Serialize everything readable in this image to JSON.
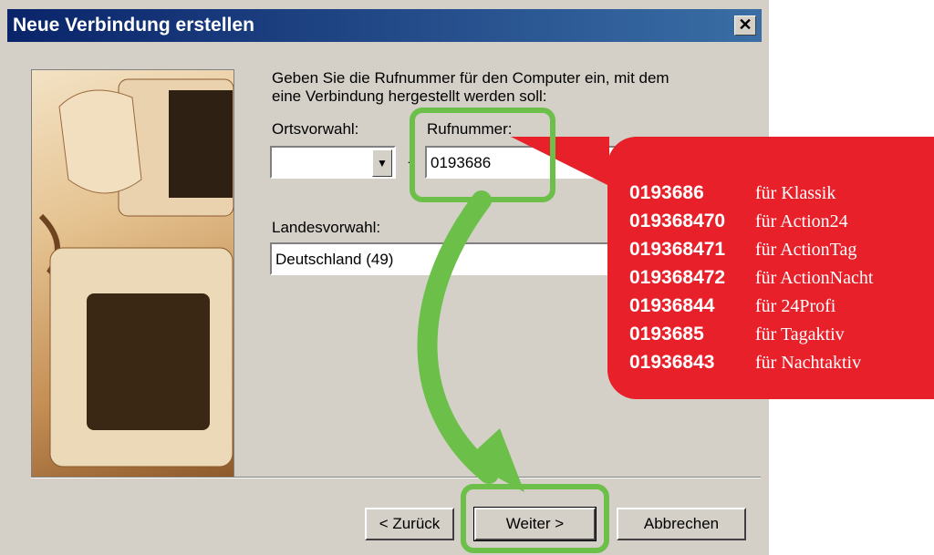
{
  "dialog": {
    "title": "Neue Verbindung erstellen",
    "close_symbol": "✕",
    "intro_line1": "Geben Sie die Rufnummer für den Computer ein, mit dem",
    "intro_line2": "eine Verbindung hergestellt werden soll:",
    "area_code_label": "Ortsvorwahl:",
    "area_code_value": "",
    "area_code_separator": "-",
    "phone_label": "Rufnummer:",
    "phone_value": "0193686",
    "country_label": "Landesvorwahl:",
    "country_value": "Deutschland (49)",
    "back_button": "< Zurück",
    "next_button": "Weiter >",
    "cancel_button": "Abbrechen"
  },
  "overlay": {
    "rows": [
      {
        "number": "0193686",
        "label": "für Klassik"
      },
      {
        "number": "019368470",
        "label": "für Action24"
      },
      {
        "number": "019368471",
        "label": "für ActionTag"
      },
      {
        "number": "019368472",
        "label": "für ActionNacht"
      },
      {
        "number": "01936844",
        "label": "für 24Profi"
      },
      {
        "number": "0193685",
        "label": "für Tagaktiv"
      },
      {
        "number": "01936843",
        "label": "für Nachtaktiv"
      }
    ]
  },
  "colors": {
    "overlay_red": "#e8202a",
    "highlight_green": "#6cc04a",
    "titlebar_blue": "#0a246a"
  },
  "icons": {
    "close": "close-icon",
    "dropdown": "chevron-down-icon",
    "arrow": "curved-arrow-icon"
  }
}
